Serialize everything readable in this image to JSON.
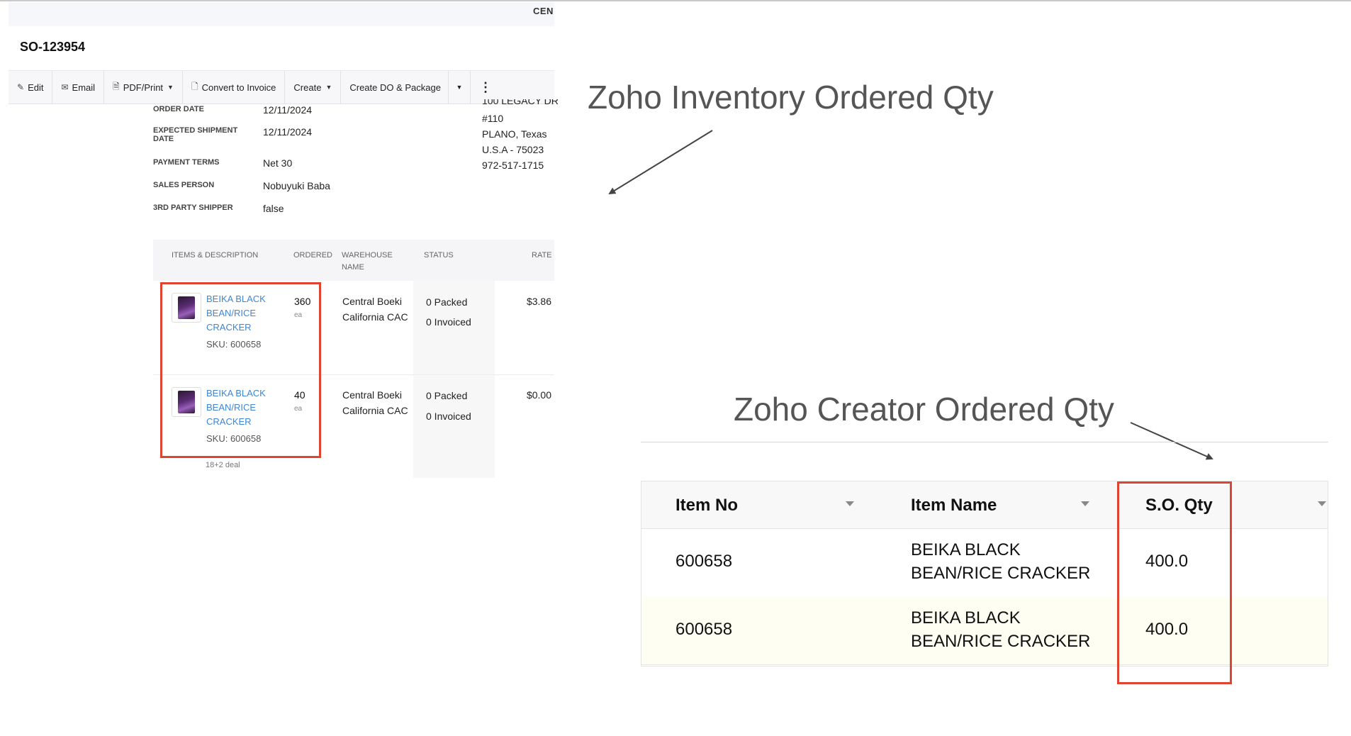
{
  "inventory": {
    "cut_header_text": "CEN",
    "so_number": "SO-123954",
    "toolbar": {
      "edit": "Edit",
      "email": "Email",
      "pdf_print": "PDF/Print",
      "convert_to_invoice": "Convert to Invoice",
      "create": "Create",
      "create_do_package": "Create DO & Package",
      "more": "⋮"
    },
    "address": {
      "line1": "100 LEGACY DR",
      "line2": "#110",
      "line3": "PLANO, Texas",
      "line4": "U.S.A - 75023",
      "line5": "972-517-1715"
    },
    "fields": {
      "order_date_label": "ORDER DATE",
      "order_date": "12/11/2024",
      "expected_shipment_label": "EXPECTED SHIPMENT DATE",
      "expected_shipment": "12/11/2024",
      "payment_terms_label": "PAYMENT TERMS",
      "payment_terms": "Net 30",
      "sales_person_label": "SALES PERSON",
      "sales_person": "Nobuyuki Baba",
      "third_party_label": "3RD PARTY SHIPPER",
      "third_party": "false"
    },
    "columns": {
      "items": "ITEMS & DESCRIPTION",
      "ordered": "ORDERED",
      "warehouse_line1": "WAREHOUSE",
      "warehouse_line2": "NAME",
      "status": "STATUS",
      "rate": "RATE"
    },
    "items": [
      {
        "name_line1": "BEIKA BLACK",
        "name_line2": "BEAN/RICE",
        "name_line3": "CRACKER",
        "sku": "SKU: 600658",
        "ordered": "360",
        "unit": "ea",
        "warehouse_line1": "Central Boeki",
        "warehouse_line2": "California CAC",
        "packed": "0  Packed",
        "invoiced": "0  Invoiced",
        "rate": "$3.86"
      },
      {
        "name_line1": "BEIKA BLACK",
        "name_line2": "BEAN/RICE",
        "name_line3": "CRACKER",
        "sku": "SKU: 600658",
        "ordered": "40",
        "unit": "ea",
        "warehouse_line1": "Central Boeki",
        "warehouse_line2": "California CAC",
        "packed": "0  Packed",
        "invoiced": "0  Invoiced",
        "rate": "$0.00"
      }
    ],
    "note": "18+2 deal"
  },
  "annotations": {
    "inventory_label": "Zoho Inventory Ordered Qty",
    "creator_label": "Zoho Creator Ordered Qty",
    "highlight_color": "#e0432f"
  },
  "creator": {
    "columns": {
      "item_no": "Item No",
      "item_name": "Item Name",
      "so_qty": "S.O. Qty"
    },
    "rows": [
      {
        "item_no": "600658",
        "name_line1": "BEIKA BLACK",
        "name_line2": "BEAN/RICE CRACKER",
        "so_qty": "400.0"
      },
      {
        "item_no": "600658",
        "name_line1": "BEIKA BLACK",
        "name_line2": "BEAN/RICE CRACKER",
        "so_qty": "400.0"
      }
    ]
  }
}
